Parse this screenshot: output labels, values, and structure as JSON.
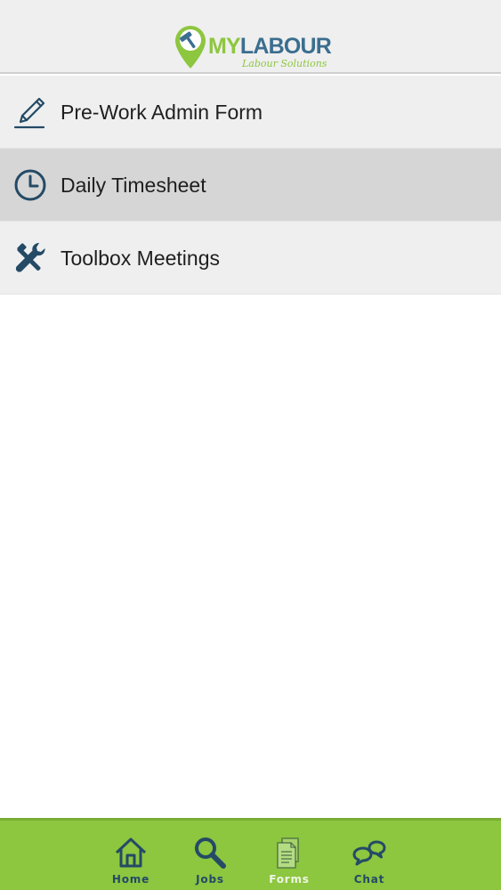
{
  "header": {
    "logo": {
      "word_my": "MY",
      "word_labour": "LABOUR",
      "tagline": "Labour Solutions",
      "icon": "map-pin-hammer-icon"
    }
  },
  "menu": {
    "items": [
      {
        "label": "Pre-Work Admin Form",
        "icon": "pencil-icon",
        "active": false
      },
      {
        "label": "Daily Timesheet",
        "icon": "clock-icon",
        "active": true
      },
      {
        "label": "Toolbox Meetings",
        "icon": "tools-icon",
        "active": false
      }
    ]
  },
  "bottom_nav": {
    "items": [
      {
        "label": "Home",
        "icon": "home-icon"
      },
      {
        "label": "Jobs",
        "icon": "search-icon"
      },
      {
        "label": "Forms",
        "icon": "document-icon",
        "active": true
      },
      {
        "label": "Chat",
        "icon": "chat-icon"
      }
    ]
  },
  "colors": {
    "brand_green": "#8dc63f",
    "brand_blue": "#3b6e8f",
    "icon_dark": "#244a66",
    "active_row": "#d6d6d6",
    "row_bg": "#efefef"
  }
}
